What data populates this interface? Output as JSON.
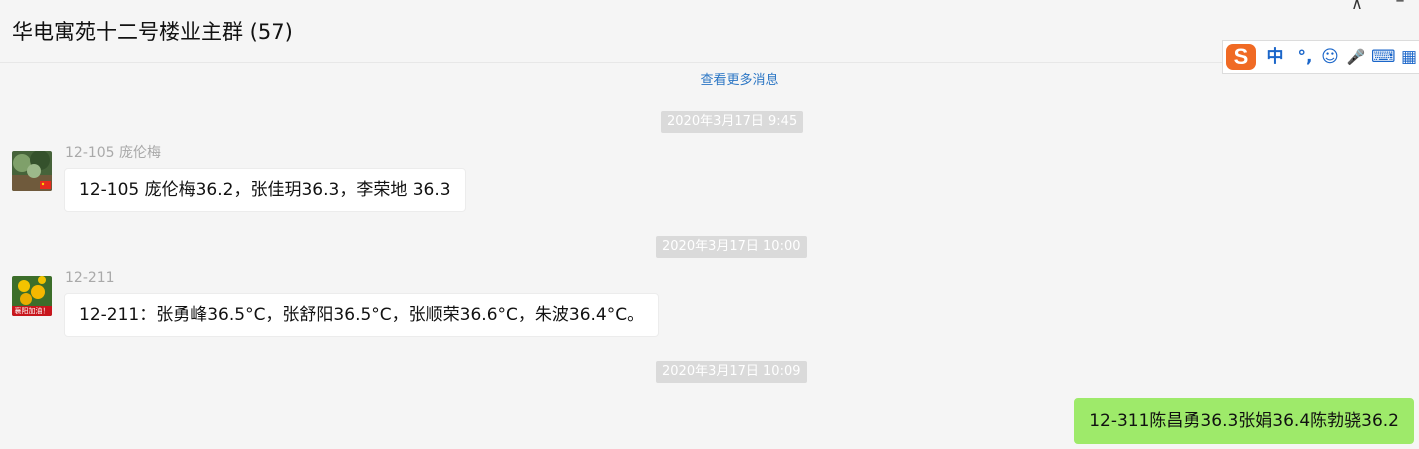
{
  "header": {
    "title": "华电寓苑十二号楼业主群 (57)",
    "pin_glyph": "⊼",
    "minimize_glyph": "–"
  },
  "ime": {
    "logo": "S",
    "items": [
      "中",
      "°,",
      "☺",
      "🎤",
      "⌨",
      "▦"
    ]
  },
  "chat": {
    "more_messages": "查看更多消息",
    "messages": [
      {
        "timestamp": "2020年3月17日 9:45",
        "sender": "12-105 庞伦梅",
        "text": "12-105 庞伦梅36.2，张佳玥36.3，李荣地 36.3"
      },
      {
        "timestamp": "2020年3月17日 10:00",
        "sender": "12-211",
        "text": "12-211：张勇峰36.5°C，张舒阳36.5°C，张顺荣36.6°C，朱波36.4°C。",
        "avatar_caption": "襄阳加油！"
      },
      {
        "timestamp": "2020年3月17日 10:09",
        "text": "12-311陈昌勇36.3张娟36.4陈勃骁36.2"
      }
    ]
  },
  "colors": {
    "background": "#f5f5f5",
    "link": "#2a75c4",
    "own_bubble": "#9eea6a",
    "timestamp_bg": "#dadada",
    "ime_accent": "#1b66c9",
    "ime_logo": "#f06a24"
  }
}
